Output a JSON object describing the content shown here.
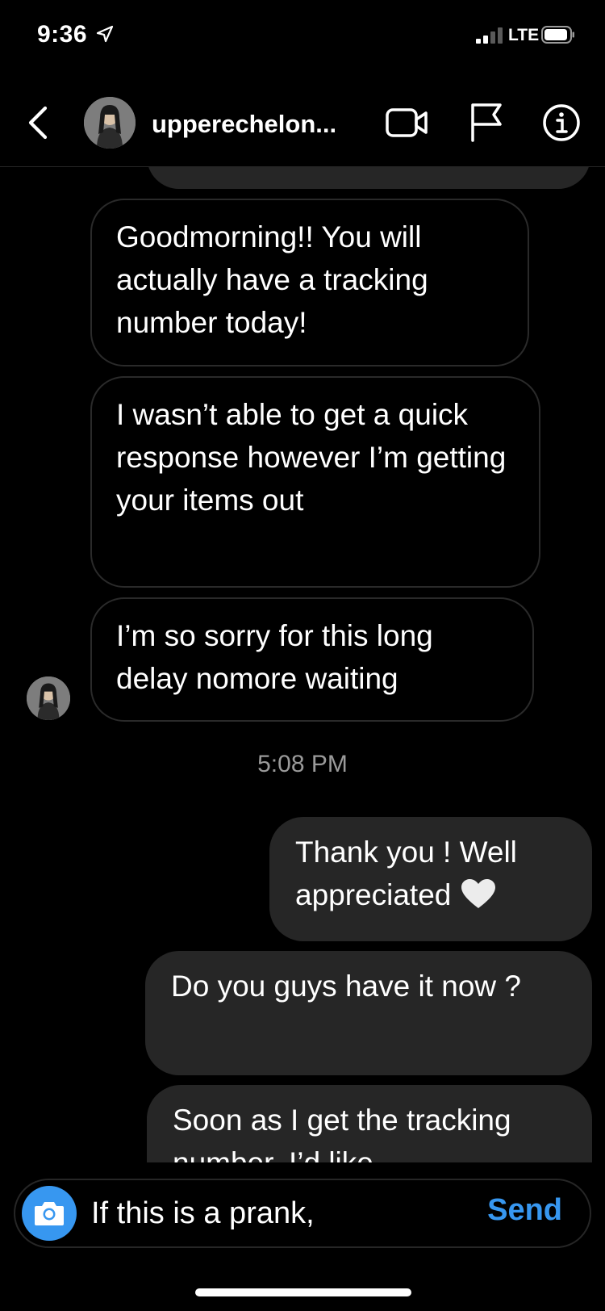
{
  "status_bar": {
    "time": "9:36",
    "network": "LTE",
    "icons": [
      "location-arrow-icon",
      "signal-bars-icon",
      "battery-icon"
    ]
  },
  "header": {
    "username": "upperechelon...",
    "icons": [
      "back-chevron-icon",
      "video-call-icon",
      "flag-icon",
      "info-icon"
    ]
  },
  "messages": {
    "incoming": [
      {
        "text": "Goodmorning!! You will actually have a tracking number today!"
      },
      {
        "text": "I wasn’t able to get a quick response however I’m getting your items out"
      },
      {
        "text": "I’m so sorry for this long delay nomore waiting"
      }
    ],
    "timestamp": "5:08 PM",
    "outgoing": [
      {
        "text": "Thank you ! Well appreciated",
        "emoji": "white-heart-icon"
      },
      {
        "text": "Do you guys have it now ?"
      },
      {
        "text": "Soon as I get the tracking number. I’d like"
      }
    ]
  },
  "composer": {
    "input_value": "If this is a prank,",
    "send_label": "Send",
    "icon": "camera-icon"
  },
  "colors": {
    "background": "#000000",
    "outgoing_bubble": "#262626",
    "incoming_border": "#2a2a2a",
    "accent": "#3797f0",
    "timestamp": "#9a9a9a"
  }
}
